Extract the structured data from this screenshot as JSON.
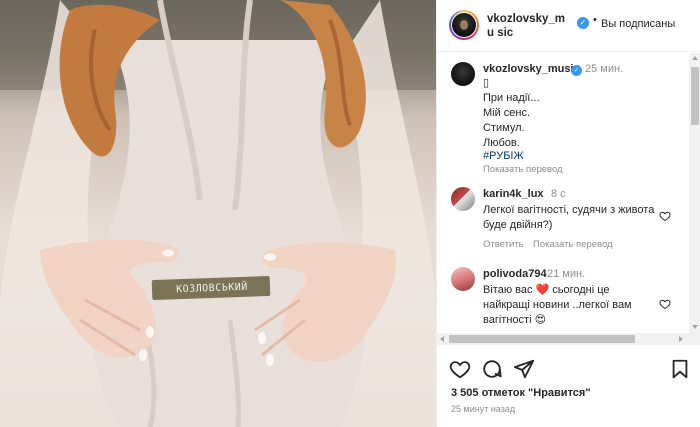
{
  "header": {
    "username": "vkozlovsky_mu sic",
    "separator": "•",
    "follow_status": "Вы подписаны"
  },
  "caption": {
    "username": "vkozlovsky_music",
    "time": "25 мин.",
    "icon": "▯",
    "lines": [
      "При надії...",
      "Мій сенс.",
      "Стимул.",
      "Любов."
    ],
    "hashtag": "#РУБІЖ",
    "translate": "Показать перевод"
  },
  "comments": [
    {
      "username": "karin4k_lux",
      "time": "8 с",
      "text_lines": [
        "Легкої вагітності, судячи з живота",
        "буде двійня?)"
      ],
      "reply": "Ответить",
      "translate": "Показать перевод"
    },
    {
      "username": "polivoda794",
      "time": "21 мин.",
      "text_lines": [
        "Вітаю вас ❤️ сьогодні це",
        "найкращі новини ..легкої вам",
        "вагітності 😍"
      ]
    }
  ],
  "photo": {
    "label_text": "КОЗЛОВСЬКИЙ"
  },
  "footer": {
    "likes": "3 505 отметок \"Нравится\"",
    "posted": "25 минут назад"
  },
  "colors": {
    "verified": "#3897f0",
    "link": "#00376b",
    "muted": "#8e8e8e"
  },
  "icons": {
    "verified": "check-icon",
    "like": "heart-icon",
    "comment": "comment-icon",
    "share": "paper-plane-icon",
    "save": "bookmark-icon"
  }
}
